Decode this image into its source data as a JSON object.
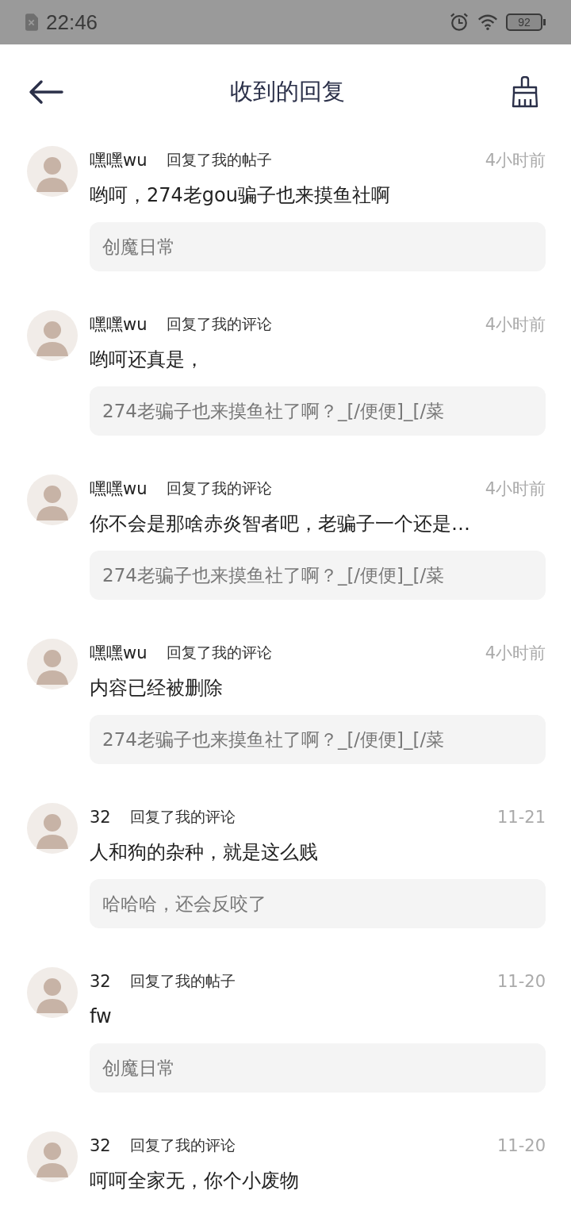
{
  "status_bar": {
    "time": "22:46",
    "battery": "92"
  },
  "header": {
    "title": "收到的回复"
  },
  "replies": [
    {
      "name": "嘿嘿wu",
      "action": "回复了我的帖子",
      "time": "4小时前",
      "content": "哟呵，274老gou骗子也来摸鱼社啊",
      "quote": "创魔日常"
    },
    {
      "name": "嘿嘿wu",
      "action": "回复了我的评论",
      "time": "4小时前",
      "content": "哟呵还真是，",
      "quote": "274老骗子也来摸鱼社了啊？_[/便便]_[/菜"
    },
    {
      "name": "嘿嘿wu",
      "action": "回复了我的评论",
      "time": "4小时前",
      "content": "你不会是那啥赤炎智者吧，老骗子一个还是…",
      "quote": "274老骗子也来摸鱼社了啊？_[/便便]_[/菜"
    },
    {
      "name": "嘿嘿wu",
      "action": "回复了我的评论",
      "time": "4小时前",
      "content": "内容已经被删除",
      "quote": "274老骗子也来摸鱼社了啊？_[/便便]_[/菜"
    },
    {
      "name": "32",
      "action": "回复了我的评论",
      "time": "11-21",
      "content": "人和狗的杂种，就是这么贱",
      "quote": "哈哈哈，还会反咬了"
    },
    {
      "name": "32",
      "action": "回复了我的帖子",
      "time": "11-20",
      "content": "fw",
      "quote": "创魔日常"
    },
    {
      "name": "32",
      "action": "回复了我的评论",
      "time": "11-20",
      "content": "呵呵全家无，你个小废物"
    }
  ]
}
